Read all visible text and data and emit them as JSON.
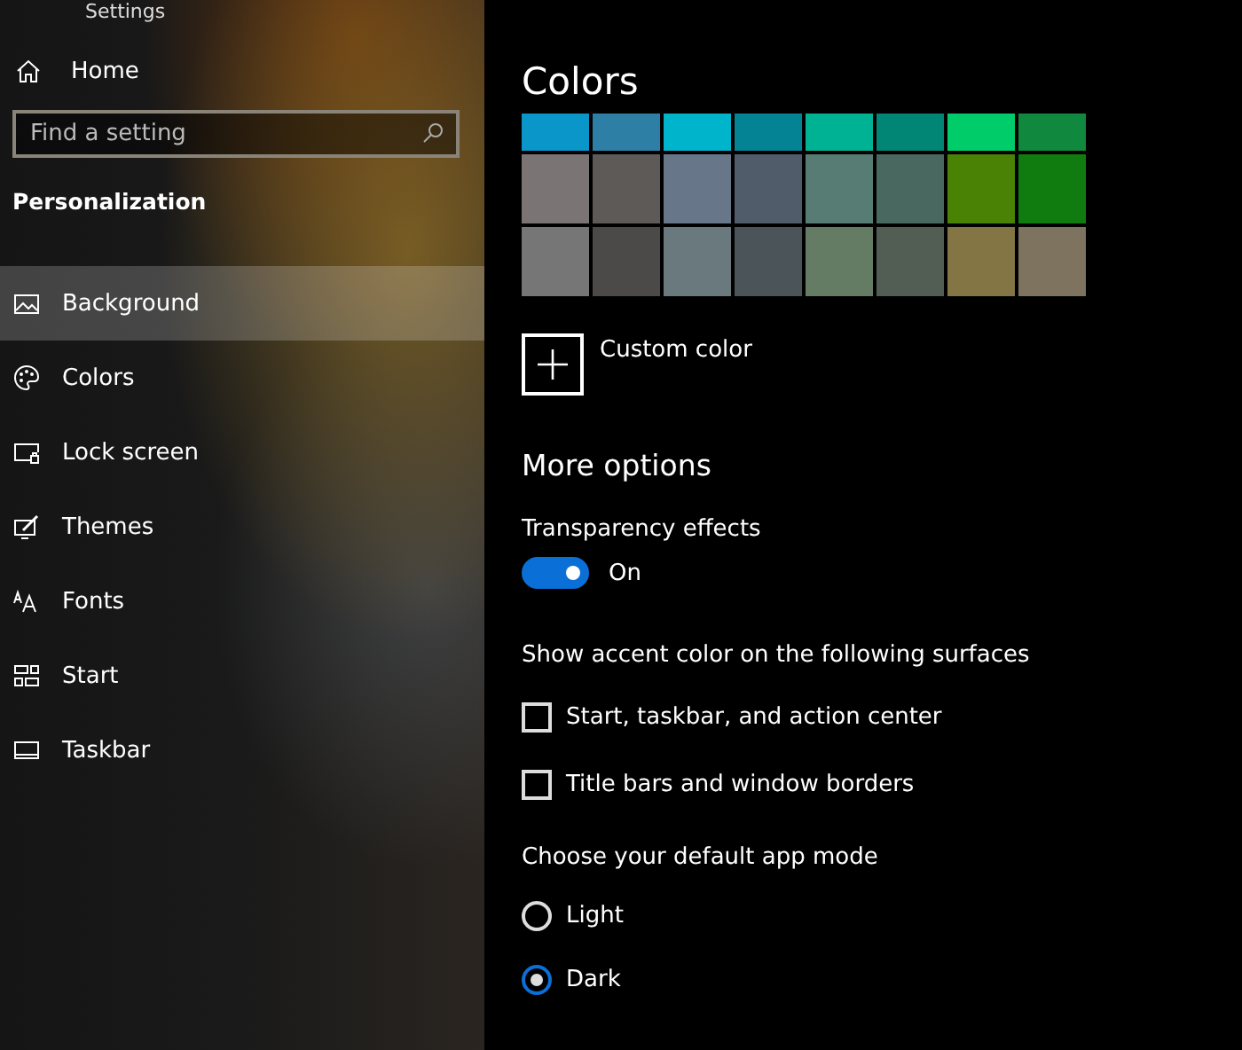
{
  "window": {
    "title": "Settings"
  },
  "sidebar": {
    "home": "Home",
    "search": {
      "placeholder": "Find a setting"
    },
    "section": "Personalization",
    "items": [
      {
        "label": "Background",
        "kind": "background",
        "selected": true
      },
      {
        "label": "Colors",
        "kind": "colors",
        "selected": false
      },
      {
        "label": "Lock screen",
        "kind": "lock",
        "selected": false
      },
      {
        "label": "Themes",
        "kind": "themes",
        "selected": false
      },
      {
        "label": "Fonts",
        "kind": "fonts",
        "selected": false
      },
      {
        "label": "Start",
        "kind": "start",
        "selected": false
      },
      {
        "label": "Taskbar",
        "kind": "taskbar",
        "selected": false
      }
    ]
  },
  "content": {
    "title": "Colors",
    "swatches": [
      {
        "color": "#0a96c8"
      },
      {
        "color": "#2d7fa6"
      },
      {
        "color": "#00b4cc"
      },
      {
        "color": "#038393"
      },
      {
        "color": "#00b294"
      },
      {
        "color": "#018574"
      },
      {
        "color": "#00cc6a"
      },
      {
        "color": "#10893e"
      },
      {
        "color": "#7a7574"
      },
      {
        "color": "#5d5a58"
      },
      {
        "color": "#68768a"
      },
      {
        "color": "#515c6b"
      },
      {
        "color": "#567c73"
      },
      {
        "color": "#486860"
      },
      {
        "color": "#498205"
      },
      {
        "color": "#107c10"
      },
      {
        "color": "#767676"
      },
      {
        "color": "#4c4a48"
      },
      {
        "color": "#69797e"
      },
      {
        "color": "#4a5459"
      },
      {
        "color": "#647c64"
      },
      {
        "color": "#525e54"
      },
      {
        "color": "#847545"
      },
      {
        "color": "#7e735f"
      }
    ],
    "custom_color": "Custom color",
    "more_options": "More options",
    "transparency": {
      "label": "Transparency effects",
      "on": true,
      "state_text": "On"
    },
    "accent_heading": "Show accent color on the following surfaces",
    "accent_options": [
      {
        "label": "Start, taskbar, and action center",
        "checked": false
      },
      {
        "label": "Title bars and window borders",
        "checked": false
      }
    ],
    "mode_heading": "Choose your default app mode",
    "modes": [
      {
        "label": "Light",
        "selected": false
      },
      {
        "label": "Dark",
        "selected": true
      }
    ]
  }
}
